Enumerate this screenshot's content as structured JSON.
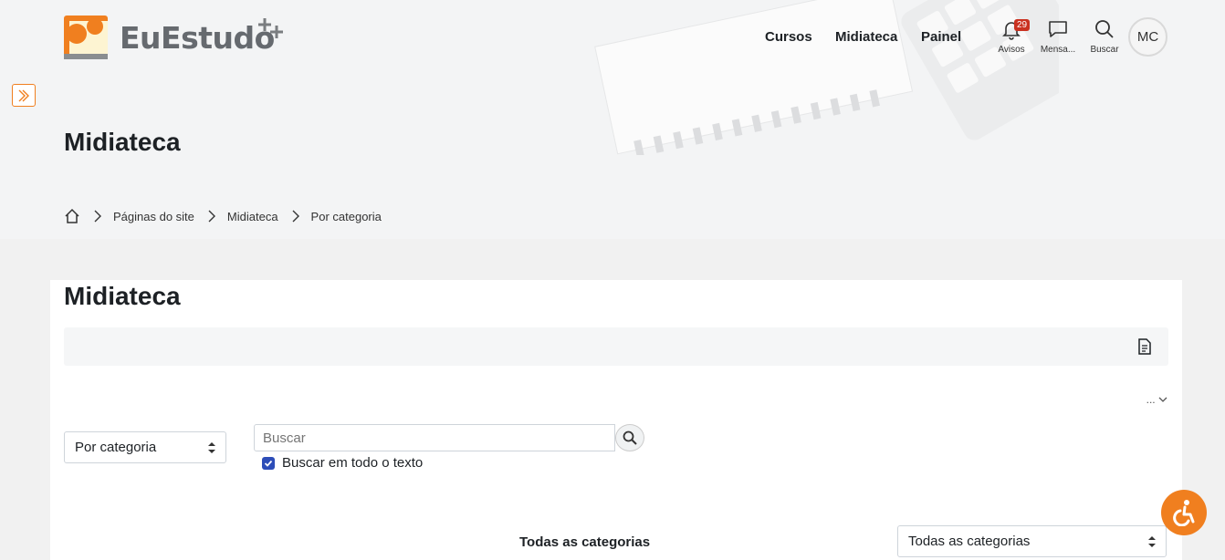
{
  "brand": {
    "name": "EuEstudo"
  },
  "nav": {
    "courses": "Cursos",
    "library": "Midiateca",
    "dashboard": "Painel"
  },
  "header_icons": {
    "notifications": {
      "label": "Avisos",
      "count": "29"
    },
    "messages": {
      "label": "Mensa..."
    },
    "search": {
      "label": "Buscar"
    }
  },
  "user": {
    "initials": "MC"
  },
  "page": {
    "hero_title": "Midiateca",
    "card_title": "Midiateca"
  },
  "breadcrumb": {
    "items": [
      "Páginas do site",
      "Midiateca",
      "Por categoria"
    ]
  },
  "more_menu": "...",
  "view_select": {
    "selected": "Por categoria"
  },
  "search": {
    "placeholder": "Buscar",
    "fulltext_label": "Buscar em todo o texto",
    "fulltext_checked": true
  },
  "categories": {
    "heading": "Todas as categorias",
    "select_selected": "Todas as categorias"
  },
  "colors": {
    "accent": "#f07f1f",
    "badge": "#ca3120",
    "checkbox": "#2d4db8"
  }
}
